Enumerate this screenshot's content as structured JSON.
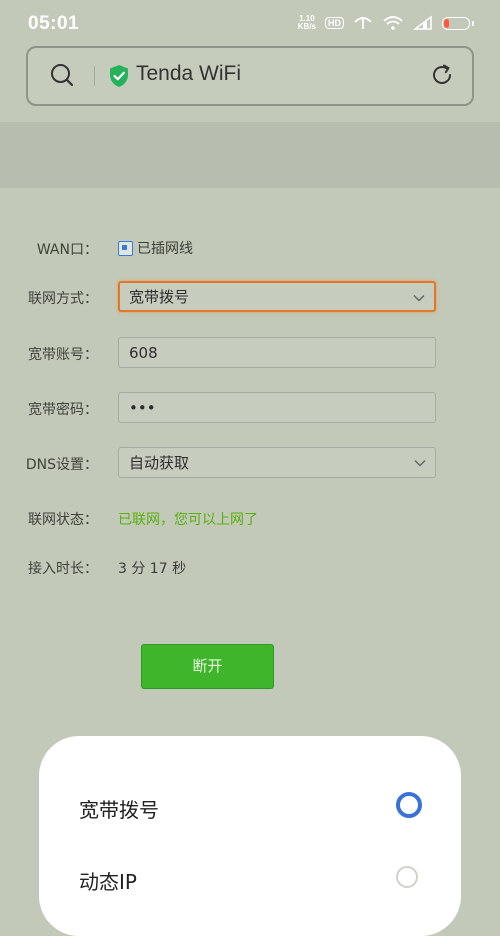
{
  "status_bar": {
    "time": "05:01",
    "net_speed_value": "1.10",
    "net_speed_unit": "KB/s",
    "hd_badge": "HD",
    "icons": [
      "wifi-calling-icon",
      "wifi-icon",
      "signal-icon",
      "battery-icon"
    ],
    "battery_color": "#ff5a3c"
  },
  "browser": {
    "title": "Tenda WiFi",
    "secure_color": "#24b35a"
  },
  "form": {
    "wan_label": "WAN口：",
    "wan_status": "已插网线",
    "conn_type_label": "联网方式：",
    "conn_type_value": "宽带拨号",
    "account_label": "宽带账号：",
    "account_value": "608",
    "password_label": "宽带密码：",
    "password_value": "•••",
    "dns_label": "DNS设置：",
    "dns_value": "自动获取",
    "net_status_label": "联网状态：",
    "net_status_value": "已联网，您可以上网了",
    "uptime_label": "接入时长：",
    "uptime_value": "3 分 17 秒",
    "disconnect_label": "断开"
  },
  "picker": {
    "options": [
      {
        "label": "宽带拨号",
        "selected": true
      },
      {
        "label": "动态IP",
        "selected": false
      }
    ],
    "accent": "#3b72d8"
  }
}
